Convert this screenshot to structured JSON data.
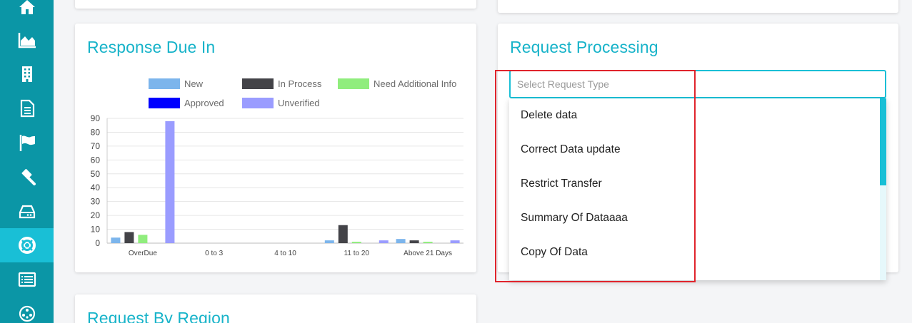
{
  "sidebar": {
    "items": [
      {
        "icon": "home-icon"
      },
      {
        "icon": "area-chart-icon"
      },
      {
        "icon": "building-icon"
      },
      {
        "icon": "document-icon"
      },
      {
        "icon": "flag-icon"
      },
      {
        "icon": "gavel-icon"
      },
      {
        "icon": "hard-drive-icon"
      },
      {
        "icon": "life-ring-icon",
        "active": true
      },
      {
        "icon": "list-icon"
      },
      {
        "icon": "network-icon"
      }
    ]
  },
  "response_due": {
    "title": "Response Due In",
    "legend": [
      {
        "label": "New",
        "color": "#7cb5ec"
      },
      {
        "label": "In Process",
        "color": "#434348"
      },
      {
        "label": "Need Additional Info",
        "color": "#90ed7d"
      },
      {
        "label": "Approved",
        "color": "#0000ff"
      },
      {
        "label": "Unverified",
        "color": "#9a9cff"
      }
    ]
  },
  "chart_data": {
    "type": "bar",
    "categories": [
      "OverDue",
      "0 to 3",
      "4 to 10",
      "11 to 20",
      "Above 21 Days"
    ],
    "series": [
      {
        "name": "New",
        "color": "#7cb5ec",
        "values": [
          4,
          0,
          0,
          2,
          3
        ]
      },
      {
        "name": "In Process",
        "color": "#434348",
        "values": [
          8,
          0,
          0,
          13,
          2
        ]
      },
      {
        "name": "Need Additional Info",
        "color": "#90ed7d",
        "values": [
          6,
          0,
          0,
          1,
          1
        ]
      },
      {
        "name": "Approved",
        "color": "#0000ff",
        "values": [
          0,
          0,
          0,
          0,
          0
        ]
      },
      {
        "name": "Unverified",
        "color": "#9a9cff",
        "values": [
          88,
          0,
          0,
          2,
          2
        ]
      }
    ],
    "ylim": [
      0,
      90
    ],
    "yticks": [
      0,
      10,
      20,
      30,
      40,
      50,
      60,
      70,
      80,
      90
    ],
    "grid": true,
    "legend_position": "top"
  },
  "request_processing": {
    "title": "Request Processing",
    "select_placeholder": "Select Request Type",
    "options": [
      "Delete data",
      "Correct Data update",
      "Restrict Transfer",
      "Summary Of Dataaaa",
      "Copy Of Data"
    ]
  },
  "request_region": {
    "title": "Request By Region"
  },
  "colors": {
    "sidebar": "#0b96a6",
    "sidebar_active": "#19bfd6",
    "accent": "#17b3c9",
    "highlight": "#e0242c"
  }
}
